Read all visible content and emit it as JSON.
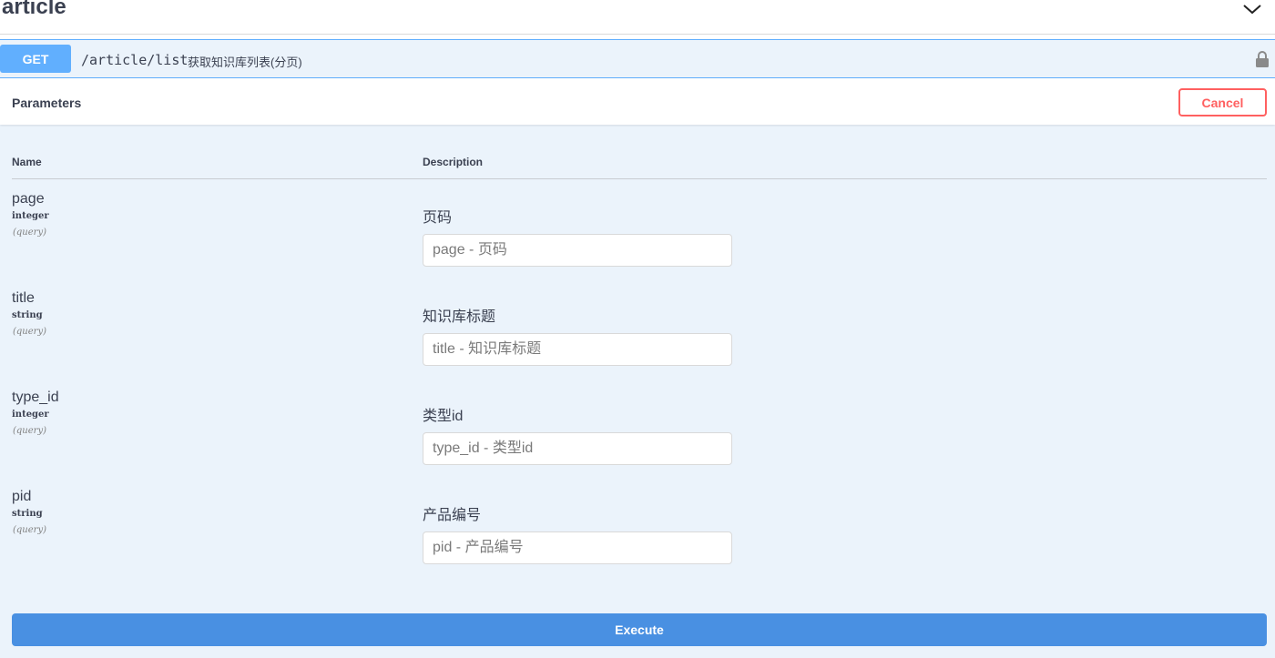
{
  "section": {
    "title": "article",
    "collapse_icon": "chevron-down-icon"
  },
  "operation": {
    "method": "GET",
    "method_color": "#61affe",
    "path": "/article/list",
    "summary": "获取知识库列表(分页)",
    "lock_icon": "lock-icon"
  },
  "parameters": {
    "title": "Parameters",
    "cancel_label": "Cancel",
    "column_name": "Name",
    "column_description": "Description",
    "items": [
      {
        "name": "page",
        "type": "integer",
        "in": "(query)",
        "description": "页码",
        "value": "",
        "placeholder": "page - 页码"
      },
      {
        "name": "title",
        "type": "string",
        "in": "(query)",
        "description": "知识库标题",
        "value": "",
        "placeholder": "title - 知识库标题"
      },
      {
        "name": "type_id",
        "type": "integer",
        "in": "(query)",
        "description": "类型id",
        "value": "",
        "placeholder": "type_id - 类型id"
      },
      {
        "name": "pid",
        "type": "string",
        "in": "(query)",
        "description": "产品编号",
        "value": "",
        "placeholder": "pid - 产品编号"
      }
    ]
  },
  "execute_label": "Execute",
  "colors": {
    "opblock_bg": "#ebf3fb",
    "cancel": "#ff6060",
    "execute": "#4990e2"
  }
}
